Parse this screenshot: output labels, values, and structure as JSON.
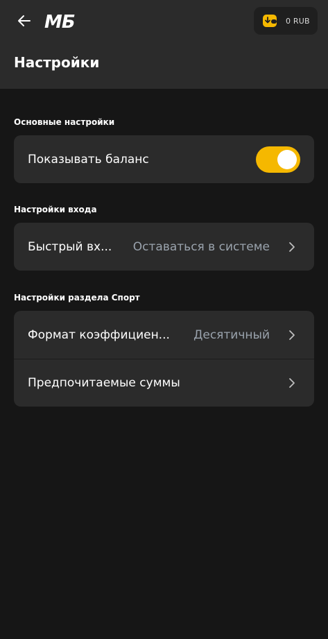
{
  "header": {
    "logo_text": "МБ",
    "balance": "0 RUB",
    "title": "Настройки"
  },
  "colors": {
    "accent": "#f5b800",
    "header_bg": "#2b2b2b",
    "page_bg": "#161616",
    "card_bg": "#2b2b2b",
    "value_text": "#9aa3ad"
  },
  "icons": {
    "back": "arrow-left-icon",
    "wallet": "wallet-icon",
    "chevron": "chevron-right-icon"
  },
  "sections": {
    "main": {
      "label": "Основные настройки",
      "show_balance": {
        "label": "Показывать баланс",
        "enabled": true
      }
    },
    "login": {
      "label": "Настройки входа",
      "quick_login": {
        "label": "Быстрый вх...",
        "value": "Оставаться в системе"
      }
    },
    "sport": {
      "label": "Настройки раздела Спорт",
      "odds_format": {
        "label": "Формат коэффициен...",
        "value": "Десятичный"
      },
      "preferred_amounts": {
        "label": "Предпочитаемые суммы"
      }
    }
  }
}
